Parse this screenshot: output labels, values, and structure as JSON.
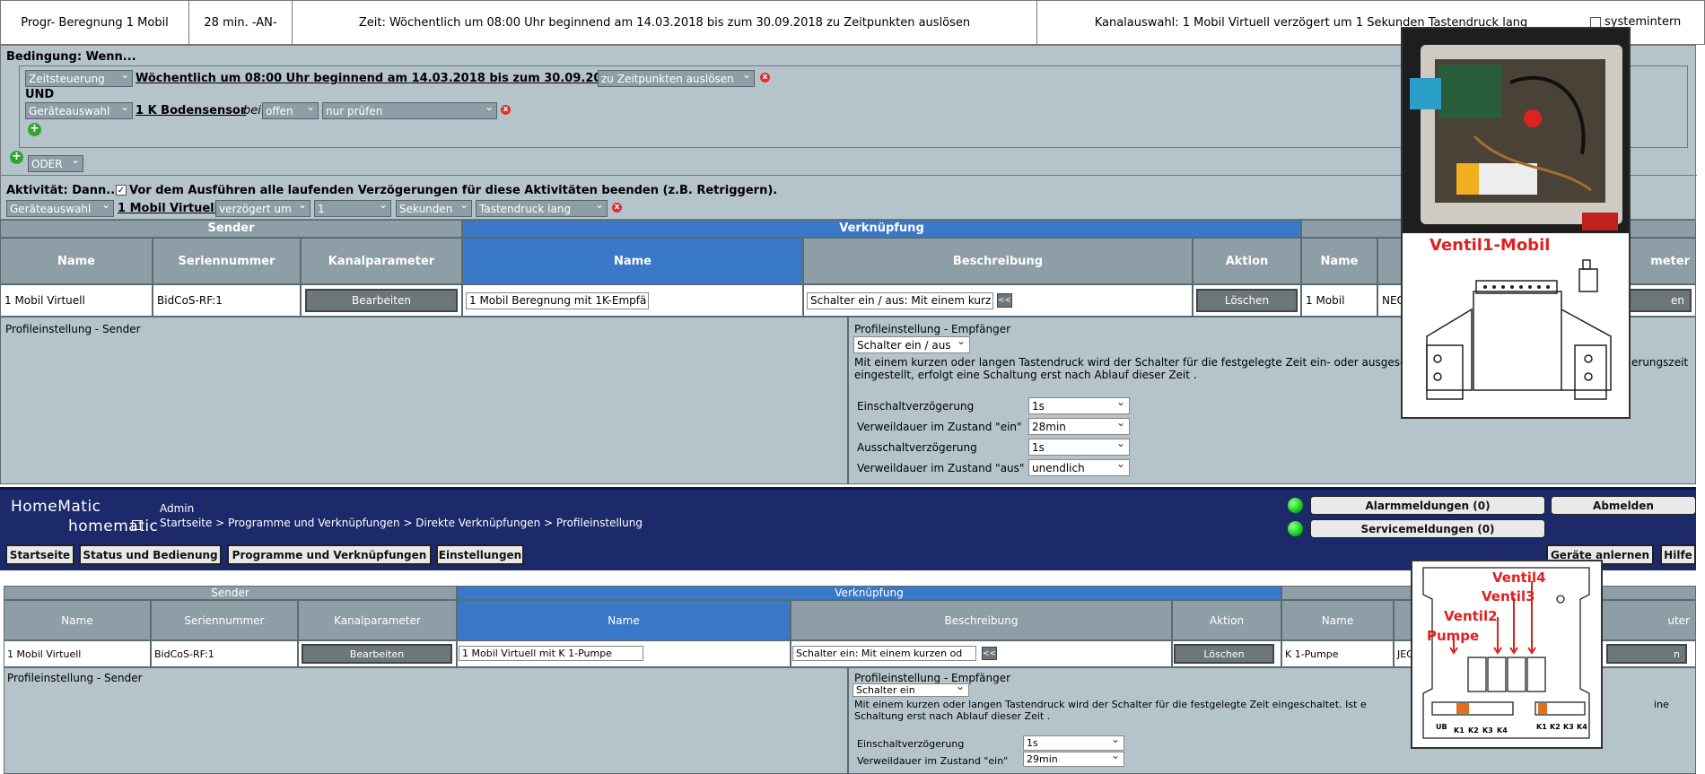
{
  "topbar": {
    "program": "Progr- Beregnung 1 Mobil",
    "duration": "28 min. -AN-",
    "time": "Zeit: Wöchentlich um 08:00 Uhr beginnend am 14.03.2018 bis zum 30.09.2018 zu Zeitpunkten auslösen",
    "channel": "Kanalauswahl: 1 Mobil Virtuell verzögert um 1 Sekunden Tastendruck lang",
    "sysintern": "systemintern"
  },
  "condition": {
    "heading": "Bedingung: Wenn...",
    "row1_select": "Zeitsteuerung",
    "row1_link": "Wöchentlich um 08:00 Uhr beginnend am 14.03.2018 bis zum 30.09.2018",
    "row1_trigger": "zu Zeitpunkten auslösen",
    "und": "UND",
    "row2_select": "Geräteauswahl",
    "row2_link": "1 K Bodensensor",
    "row2_bei": "bei",
    "row2_state": "offen",
    "row2_check": "nur prüfen",
    "oder": "ODER"
  },
  "activity": {
    "heading": "Aktivität: Dann...",
    "checkbox_text": "Vor dem Ausführen alle laufenden Verzögerungen für diese Aktivitäten beenden (z.B. Retriggern).",
    "select": "Geräteauswahl",
    "link": "1 Mobil Virtuell",
    "delay": "verzögert um",
    "delay_value": "1",
    "unit": "Sekunden",
    "key": "Tastendruck lang"
  },
  "table1": {
    "sender": "Sender",
    "verknuepfung": "Verknüpfung",
    "headers": [
      "Name",
      "Seriennummer",
      "Kanalparameter",
      "Name",
      "Beschreibung",
      "Aktion",
      "Name",
      "meter"
    ],
    "row": {
      "name": "1 Mobil Virtuell",
      "serial": "BidCoS-RF:1",
      "edit": "Bearbeiten",
      "link_name": "1 Mobil Beregnung  mit 1K-Empfä",
      "desc": "Schalter ein / aus: Mit einem kurz",
      "arrow": "<<",
      "delete": "Löschen",
      "recv_name": "1 Mobil",
      "recv_serial": "NEQ",
      "recv_btn": "en"
    }
  },
  "profile1": {
    "sender_label": "Profileinstellung - Sender",
    "recv_label": "Profileinstellung - Empfänger",
    "select": "Schalter ein / aus",
    "desc_line1": "Mit einem kurzen oder langen Tastendruck wird der Schalter für die festgelegte Zeit ein- oder ausgesc",
    "desc_line1_tail": "erungszeit",
    "desc_line2": "eingestellt, erfolgt eine Schaltung erst nach Ablauf dieser Zeit .",
    "params": [
      {
        "label": "Einschaltverzögerung",
        "value": "1s"
      },
      {
        "label": "Verweildauer im Zustand \"ein\"",
        "value": "28min"
      },
      {
        "label": "Ausschaltverzögerung",
        "value": "1s"
      },
      {
        "label": "Verweildauer im Zustand \"aus\"",
        "value": "unendlich"
      }
    ]
  },
  "homematic": {
    "logo_top": "HomeMatic",
    "logo_bottom": "homematic",
    "user": "Admin",
    "breadcrumb": "Startseite > Programme und Verknüpfungen > Direkte Verknüpfungen > Profileinstellung",
    "nav": [
      "Startseite",
      "Status und Bedienung",
      "Programme und Verknüpfungen",
      "Einstellungen"
    ],
    "alarm": "Alarmmeldungen (0)",
    "service": "Servicemeldungen (0)",
    "logout": "Abmelden",
    "add_devices": "Geräte anlernen",
    "help": "Hilfe"
  },
  "table2": {
    "sender": "Sender",
    "verknuepfung": "Verknüpfung",
    "headers": [
      "Name",
      "Seriennummer",
      "Kanalparameter",
      "Name",
      "Beschreibung",
      "Aktion",
      "Name",
      "uter"
    ],
    "row": {
      "name": "1 Mobil Virtuell",
      "serial": "BidCoS-RF:1",
      "edit": "Bearbeiten",
      "link_name": "1 Mobil Virtuell mit K 1-Pumpe",
      "desc": "Schalter ein: Mit einem kurzen od",
      "arrow": "<<",
      "delete": "Löschen",
      "recv_name": "K 1-Pumpe",
      "recv_serial": "JEQ",
      "recv_btn": "n"
    }
  },
  "profile2": {
    "sender_label": "Profileinstellung - Sender",
    "recv_label": "Profileinstellung - Empfänger",
    "select": "Schalter ein",
    "desc_line1": "Mit einem kurzen oder langen Tastendruck wird der Schalter für die festgelegte Zeit eingeschaltet. Ist e",
    "desc_line1_tail": "ine",
    "desc_line2": "Schaltung erst nach Ablauf dieser Zeit .",
    "params": [
      {
        "label": "Einschaltverzögerung",
        "value": "1s"
      },
      {
        "label": "Verweildauer im Zustand \"ein\"",
        "value": "29min"
      }
    ]
  },
  "overlay1": {
    "title": "Ventil1-Mobil",
    "title_color": "#e02020"
  },
  "overlay2": {
    "labels": [
      "Ventil4",
      "Ventil3",
      "Ventil2",
      "Pumpe"
    ],
    "terminals": [
      "UB",
      "K1",
      "K2",
      "K3",
      "K4",
      "K1",
      "K2",
      "K3",
      "K4"
    ],
    "label_color": "#e02020"
  }
}
